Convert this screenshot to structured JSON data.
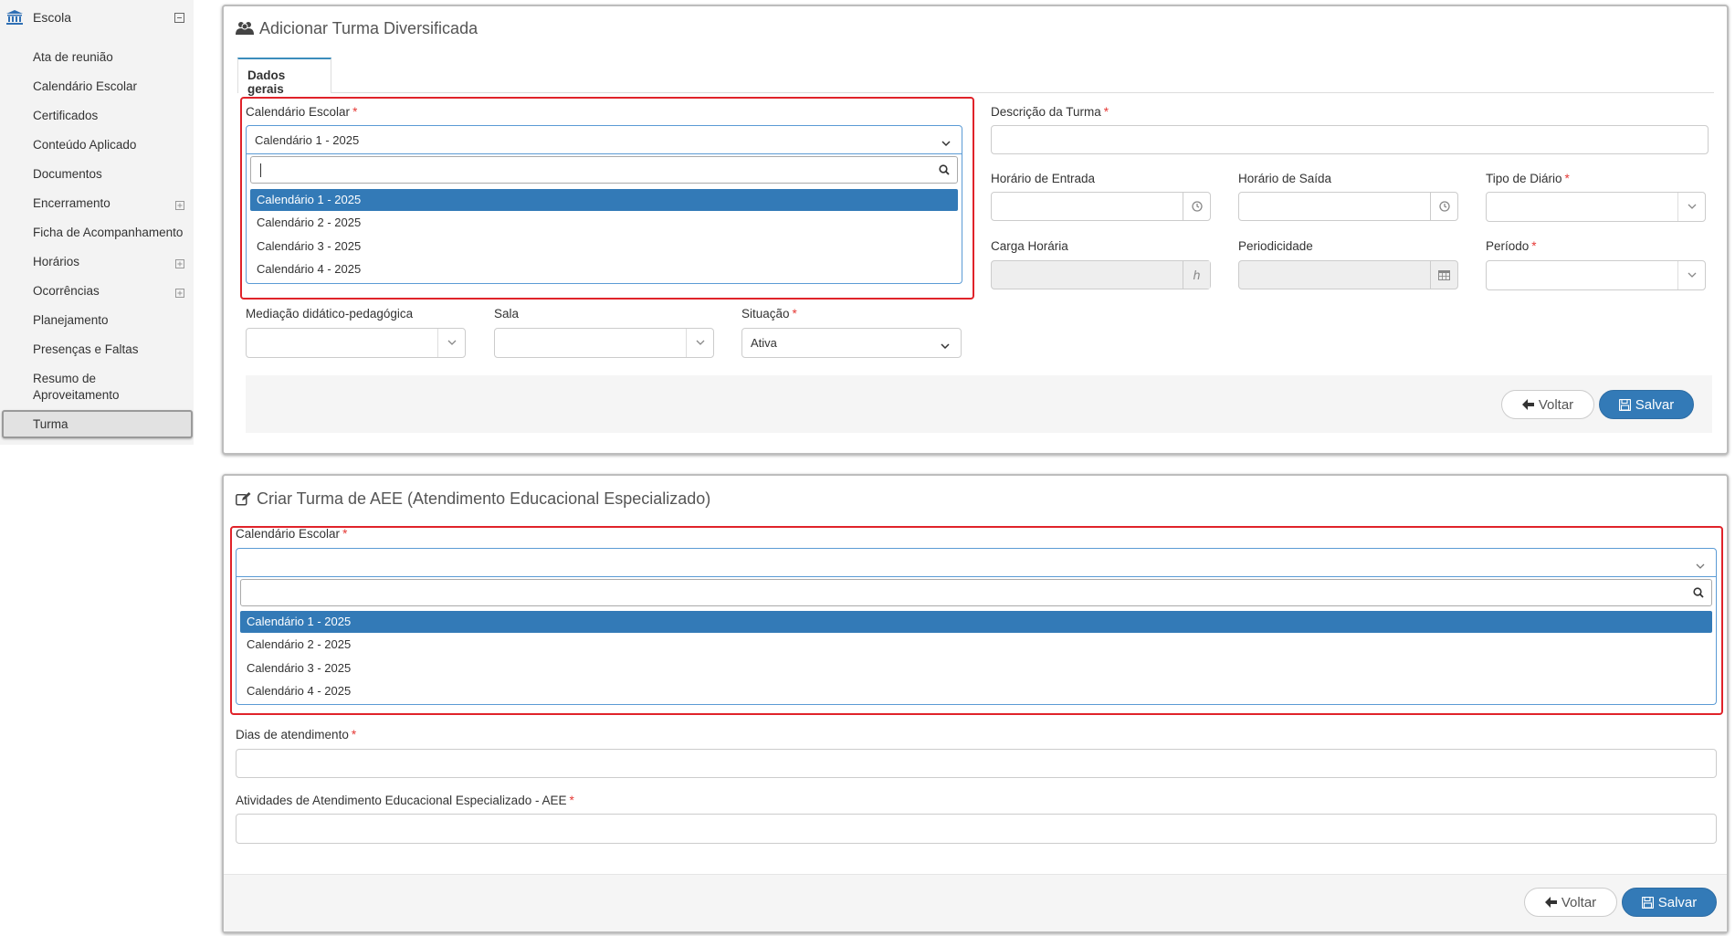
{
  "sidebar": {
    "header_label": "Escola",
    "items": [
      {
        "label": "Ata de reunião",
        "expandable": false
      },
      {
        "label": "Calendário Escolar",
        "expandable": false
      },
      {
        "label": "Certificados",
        "expandable": false
      },
      {
        "label": "Conteúdo Aplicado",
        "expandable": false
      },
      {
        "label": "Documentos",
        "expandable": false
      },
      {
        "label": "Encerramento",
        "expandable": true
      },
      {
        "label": "Ficha de Acompanhamento",
        "expandable": false
      },
      {
        "label": "Horários",
        "expandable": true
      },
      {
        "label": "Ocorrências",
        "expandable": true
      },
      {
        "label": "Planejamento",
        "expandable": false
      },
      {
        "label": "Presenças e Faltas",
        "expandable": false
      },
      {
        "label": "Resumo de Aproveitamento",
        "expandable": false
      }
    ],
    "active_item": "Turma"
  },
  "panel1": {
    "title": "Adicionar Turma Diversificada",
    "tab": "Dados gerais",
    "calendario": {
      "label": "Calendário Escolar",
      "value": "Calendário 1 - 2025",
      "options": [
        "Calendário 1 - 2025",
        "Calendário 2 - 2025",
        "Calendário 3 - 2025",
        "Calendário 4 - 2025"
      ],
      "selected_index": 0
    },
    "descricao_label": "Descrição da Turma",
    "horario_entrada_label": "Horário de Entrada",
    "horario_saida_label": "Horário de Saída",
    "tipo_diario_label": "Tipo de Diário",
    "carga_horaria_label": "Carga Horária",
    "carga_horaria_addon": "h",
    "periodicidade_label": "Periodicidade",
    "periodo_label": "Período",
    "mediacao_label": "Mediação didático-pedagógica",
    "sala_label": "Sala",
    "situacao_label": "Situação",
    "situacao_value": "Ativa",
    "voltar": "Voltar",
    "salvar": "Salvar"
  },
  "panel2": {
    "title": "Criar Turma de AEE (Atendimento Educacional Especializado)",
    "calendario": {
      "label": "Calendário Escolar",
      "options": [
        "Calendário 1 - 2025",
        "Calendário 2 - 2025",
        "Calendário 3 - 2025",
        "Calendário 4 - 2025"
      ],
      "selected_index": 0
    },
    "dias_label": "Dias de atendimento",
    "atividades_label": "Atividades de Atendimento Educacional Especializado - AEE",
    "voltar": "Voltar",
    "salvar": "Salvar"
  },
  "colors": {
    "accent": "#337ab7",
    "highlight_border": "#e0232a",
    "required": "#e53935",
    "sidebar_bg": "#f3f3f3"
  },
  "icons": [
    "bank-icon",
    "collapse-minus-icon",
    "expand-plus-icon",
    "users-icon",
    "edit-icon",
    "chevron-down-icon",
    "search-icon",
    "clock-icon",
    "calendar-icon",
    "arrow-left-icon",
    "save-icon"
  ]
}
